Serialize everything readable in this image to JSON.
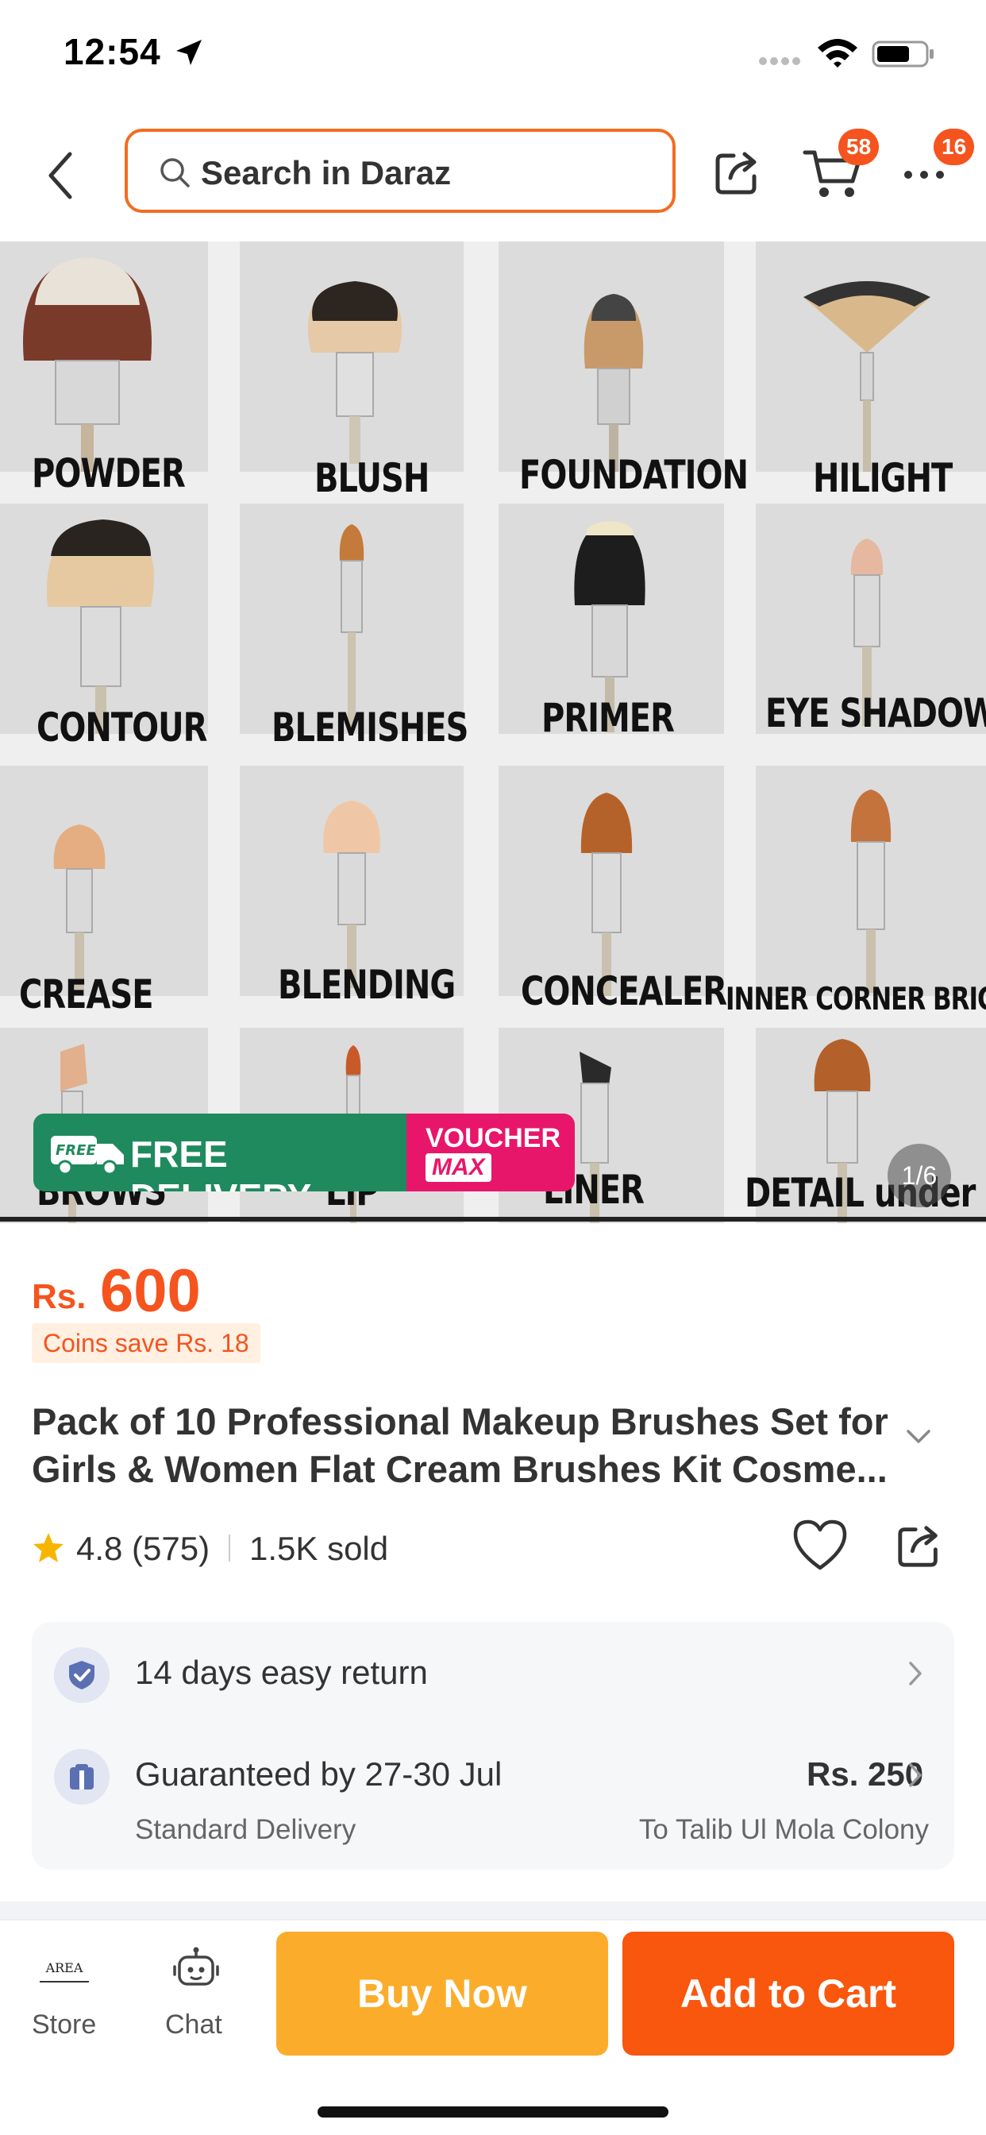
{
  "status_bar": {
    "time": "12:54"
  },
  "header": {
    "search_placeholder": "Search in Daraz",
    "cart_badge": "58",
    "more_badge": "16"
  },
  "gallery": {
    "labels": [
      "POWDER",
      "BLUSH",
      "FOUNDATION",
      "HILIGHT",
      "CONTOUR",
      "BLEMISHES",
      "PRIMER",
      "EYE SHADOW",
      "CREASE",
      "BLENDING",
      "CONCEALER",
      "INNER CORNER BRIGHTEN",
      "BROWS",
      "LIP",
      "LINER",
      "DETAIL under eye"
    ],
    "promo_free_tag": "FREE",
    "promo_free": "FREE DELIVERY",
    "promo_voucher_1": "VOUCHER",
    "promo_voucher_2": "MAX",
    "counter": "1/6"
  },
  "product": {
    "currency": "Rs.",
    "price": "600",
    "coins": "Coins save Rs. 18",
    "title": "Pack of 10 Professional Makeup Brushes Set for Girls & Women Flat Cream Brushes Kit Cosme...",
    "rating": "4.8 (575)",
    "sold": "1.5K sold"
  },
  "info": {
    "return": "14 days easy return",
    "guarantee": "Guaranteed by 27-30 Jul",
    "delivery_type": "Standard Delivery",
    "fee": "Rs. 250",
    "destination": "To Talib Ul Mola Colony"
  },
  "bottom_bar": {
    "store_logo": "AREA",
    "store": "Store",
    "chat": "Chat",
    "buy_now": "Buy Now",
    "add_to_cart": "Add to Cart"
  },
  "colors": {
    "accent": "#f5541e",
    "buy_now": "#fbac2a",
    "add_to_cart": "#f9560e",
    "free_delivery": "#1f8a5e",
    "voucher": "#e8166b"
  }
}
